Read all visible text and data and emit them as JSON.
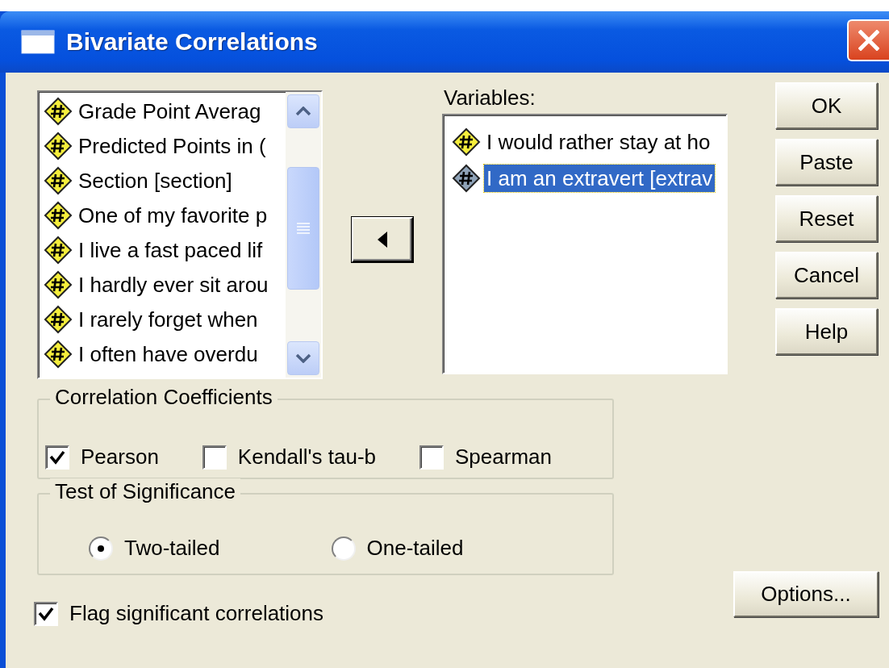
{
  "window": {
    "title": "Bivariate Correlations"
  },
  "source_list": {
    "items": [
      {
        "label": "Grade Point Averag",
        "selected": false
      },
      {
        "label": "Predicted Points in (",
        "selected": false
      },
      {
        "label": "Section [section]",
        "selected": false
      },
      {
        "label": "One of my favorite p",
        "selected": false
      },
      {
        "label": "I live a fast paced lif",
        "selected": false
      },
      {
        "label": "I hardly ever sit arou",
        "selected": false
      },
      {
        "label": "I rarely forget when",
        "selected": false
      },
      {
        "label": "I often have overdu",
        "selected": false
      }
    ]
  },
  "variables": {
    "label": "Variables:",
    "items": [
      {
        "label": "I would rather stay at ho",
        "selected": false
      },
      {
        "label": "I am an extravert [extrav",
        "selected": true
      }
    ]
  },
  "buttons": [
    {
      "label": "OK"
    },
    {
      "label": "Paste"
    },
    {
      "label": "Reset"
    },
    {
      "label": "Cancel"
    },
    {
      "label": "Help"
    }
  ],
  "correlation_coefficients": {
    "title": "Correlation Coefficients",
    "options": [
      {
        "label": "Pearson",
        "checked": true
      },
      {
        "label": "Kendall's tau-b",
        "checked": false
      },
      {
        "label": "Spearman",
        "checked": false
      }
    ]
  },
  "test_of_significance": {
    "title": "Test of Significance",
    "options": [
      {
        "label": "Two-tailed",
        "selected": true
      },
      {
        "label": "One-tailed",
        "selected": false
      }
    ]
  },
  "flag": {
    "label": "Flag significant correlations",
    "checked": true
  },
  "options_button": {
    "label": "Options..."
  }
}
